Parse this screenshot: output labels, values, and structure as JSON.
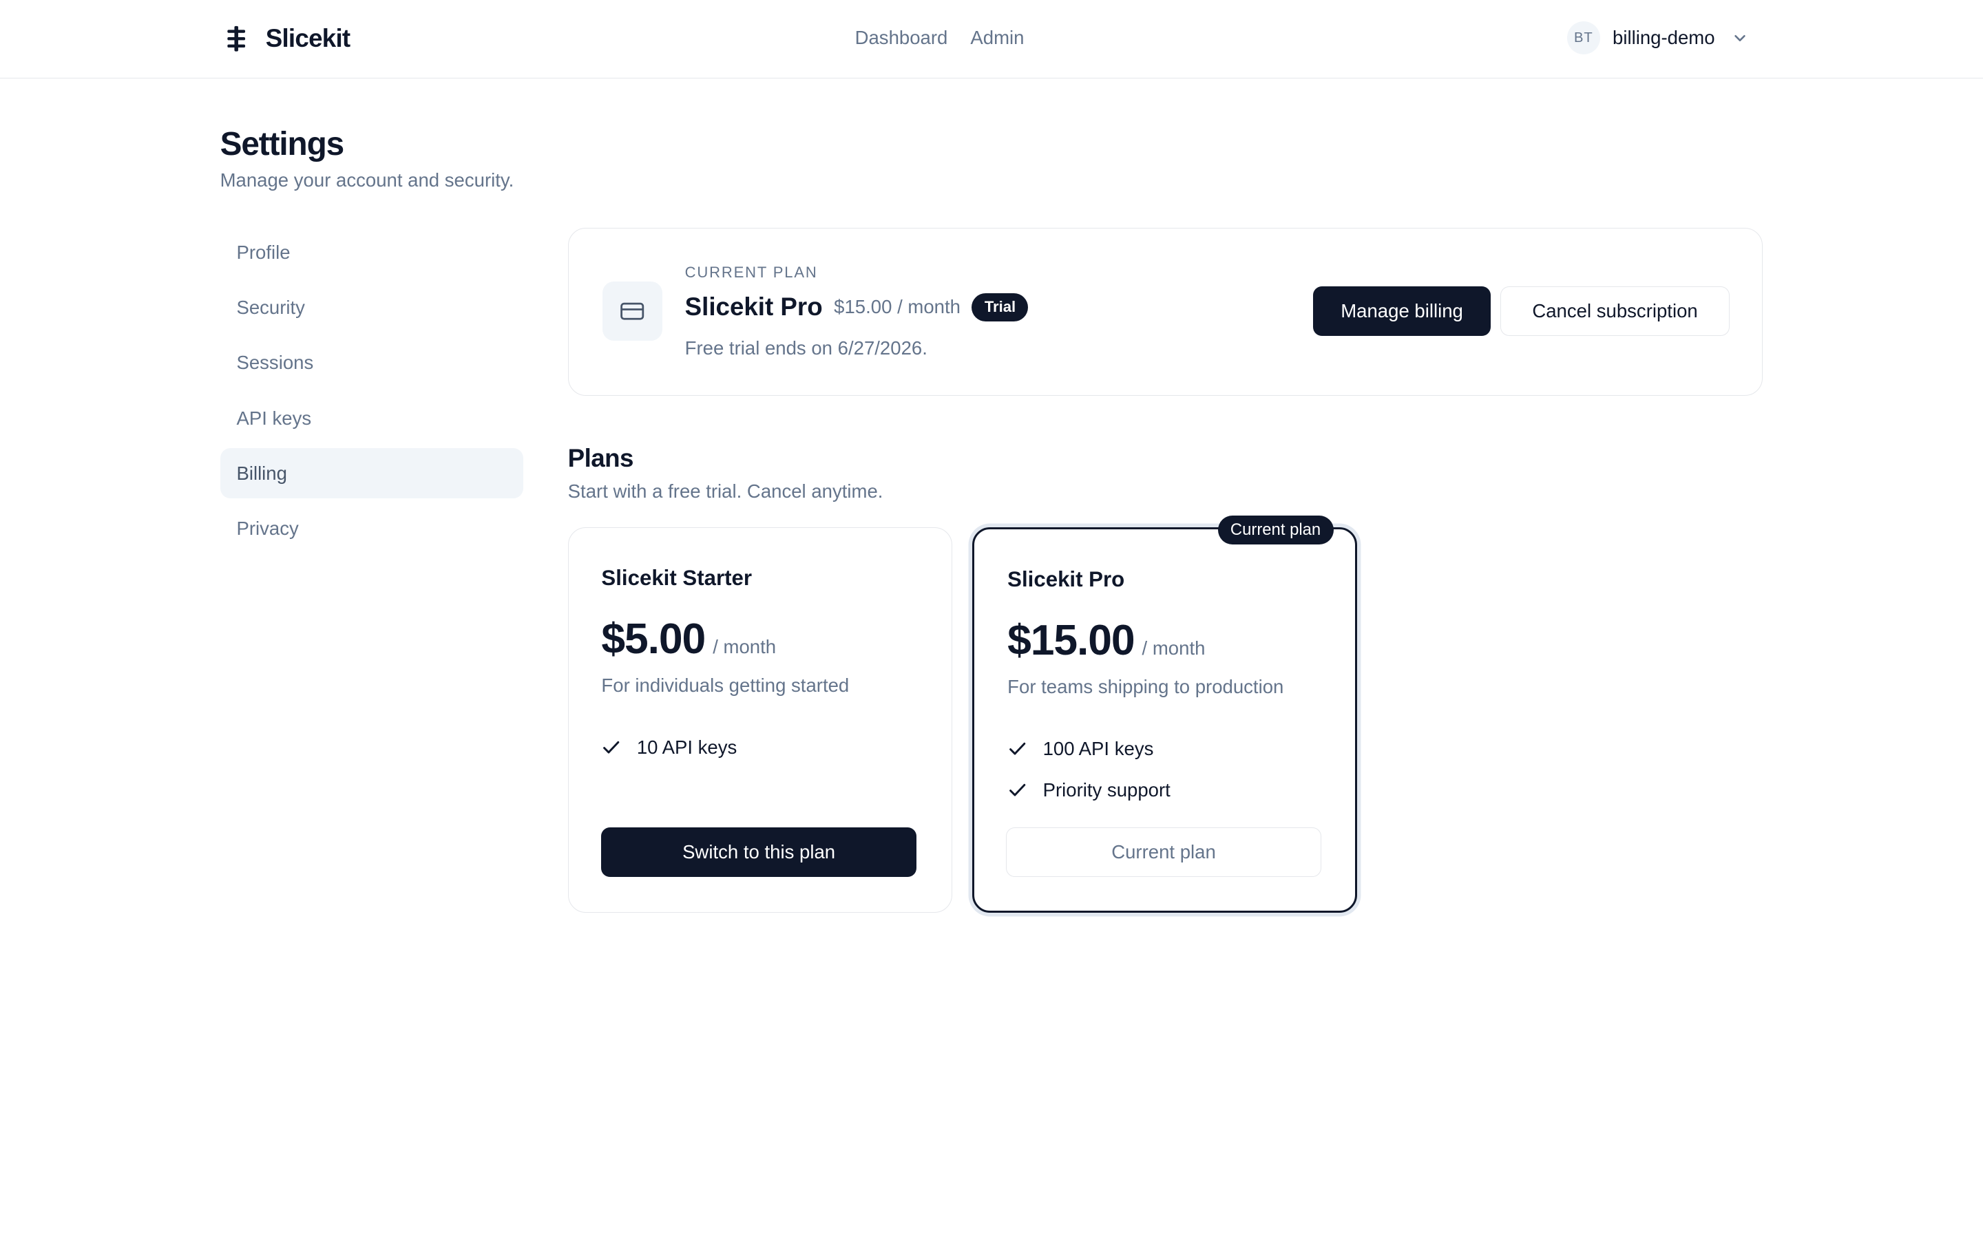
{
  "header": {
    "brand": "Slicekit",
    "nav": [
      {
        "label": "Dashboard"
      },
      {
        "label": "Admin"
      }
    ],
    "user": {
      "initials": "BT",
      "name": "billing-demo"
    }
  },
  "page": {
    "title": "Settings",
    "subtitle": "Manage your account and security."
  },
  "sidebar": {
    "items": [
      {
        "label": "Profile"
      },
      {
        "label": "Security"
      },
      {
        "label": "Sessions"
      },
      {
        "label": "API keys"
      },
      {
        "label": "Billing",
        "active": true
      },
      {
        "label": "Privacy"
      }
    ]
  },
  "current_plan": {
    "eyebrow": "CURRENT PLAN",
    "name": "Slicekit Pro",
    "price": "$15.00 / month",
    "badge": "Trial",
    "note": "Free trial ends on 6/27/2026.",
    "manage_label": "Manage billing",
    "cancel_label": "Cancel subscription"
  },
  "plans": {
    "title": "Plans",
    "subtitle": "Start with a free trial. Cancel anytime.",
    "tiers": [
      {
        "name": "Slicekit Starter",
        "amount": "$5.00",
        "period": "/ month",
        "description": "For individuals getting started",
        "features": [
          "10 API keys"
        ],
        "button": "Switch to this plan"
      },
      {
        "name": "Slicekit Pro",
        "amount": "$15.00",
        "period": "/ month",
        "description": "For teams shipping to production",
        "features": [
          "100 API keys",
          "Priority support"
        ],
        "button": "Current plan",
        "pill": "Current plan"
      }
    ]
  },
  "colors": {
    "primary": "#0f172a",
    "muted": "#64748b",
    "border": "#e5e7eb",
    "surface": "#f1f5f9"
  }
}
